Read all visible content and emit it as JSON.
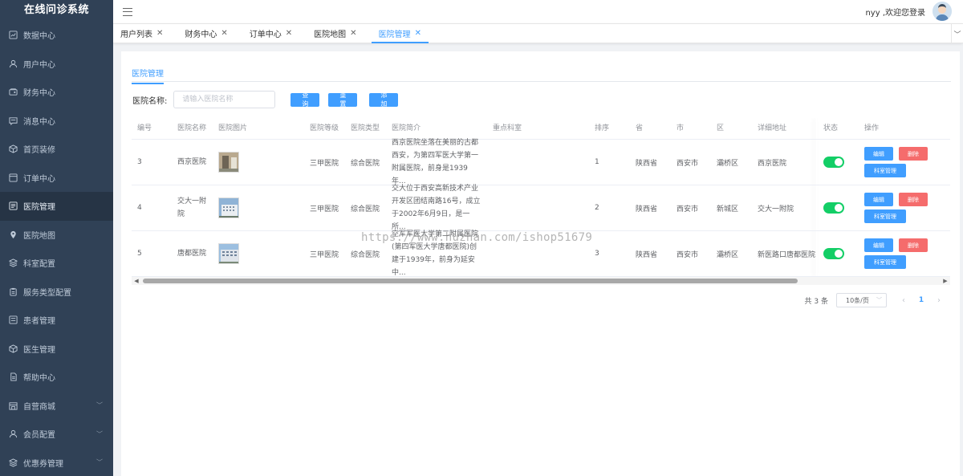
{
  "app": {
    "title": "在线问诊系统"
  },
  "sidebar": {
    "items": [
      {
        "label": "数据中心",
        "icon": "chart-icon"
      },
      {
        "label": "用户中心",
        "icon": "user-icon"
      },
      {
        "label": "财务中心",
        "icon": "wallet-icon"
      },
      {
        "label": "消息中心",
        "icon": "message-icon"
      },
      {
        "label": "首页装修",
        "icon": "box-icon"
      },
      {
        "label": "订单中心",
        "icon": "order-icon"
      },
      {
        "label": "医院管理",
        "icon": "list-icon"
      },
      {
        "label": "医院地图",
        "icon": "map-pin-icon"
      },
      {
        "label": "科室配置",
        "icon": "layers-icon"
      },
      {
        "label": "服务类型配置",
        "icon": "clipboard-icon"
      },
      {
        "label": "患者管理",
        "icon": "patient-icon"
      },
      {
        "label": "医生管理",
        "icon": "doctor-icon"
      },
      {
        "label": "帮助中心",
        "icon": "help-icon"
      },
      {
        "label": "自营商城",
        "icon": "shop-icon"
      },
      {
        "label": "会员配置",
        "icon": "member-icon"
      },
      {
        "label": "优惠券管理",
        "icon": "coupon-icon"
      }
    ]
  },
  "header": {
    "greeting": "nyy ,欢迎您登录"
  },
  "tabs": [
    {
      "label": "用户列表"
    },
    {
      "label": "财务中心"
    },
    {
      "label": "订单中心"
    },
    {
      "label": "医院地图"
    },
    {
      "label": "医院管理"
    }
  ],
  "page": {
    "tab_label": "医院管理"
  },
  "search": {
    "label": "医院名称:",
    "placeholder": "请输入医院名称",
    "query_label": "查询",
    "reset_label": "重置",
    "add_label": "添加"
  },
  "table": {
    "columns": [
      "编号",
      "医院名称",
      "医院图片",
      "医院等级",
      "医院类型",
      "医院简介",
      "重点科室",
      "排序",
      "省",
      "市",
      "区",
      "详细地址",
      "状态",
      "操作"
    ],
    "rows": [
      {
        "id": "3",
        "name": "西京医院",
        "level": "三甲医院",
        "type": "综合医院",
        "desc": "西京医院坐落在美丽的古都西安，为第四军医大学第一附属医院，前身是1939年...",
        "dept": "",
        "sort": "1",
        "province": "陕西省",
        "city": "西安市",
        "district": "灞桥区",
        "address": "西京医院",
        "status": true
      },
      {
        "id": "4",
        "name": "交大一附院",
        "level": "三甲医院",
        "type": "综合医院",
        "desc": "交大位于西安高新技术产业开发区团结南路16号，成立于2002年6月9日，是一所...",
        "dept": "",
        "sort": "2",
        "province": "陕西省",
        "city": "西安市",
        "district": "新城区",
        "address": "交大一附院",
        "status": true
      },
      {
        "id": "5",
        "name": "唐都医院",
        "level": "三甲医院",
        "type": "综合医院",
        "desc": "空军军医大学第二附属医院(第四军医大学唐都医院)创建于1939年，前身为延安中...",
        "dept": "",
        "sort": "3",
        "province": "陕西省",
        "city": "西安市",
        "district": "灞桥区",
        "address": "新医路口唐都医院",
        "status": true
      }
    ],
    "actions": {
      "edit": "编辑",
      "delete": "删除",
      "dept": "科室管理"
    }
  },
  "pagination": {
    "total": "共 3 条",
    "page_size": "10条/页",
    "current": "1"
  },
  "watermark": "https://www.huzhan.com/ishop51679",
  "colors": {
    "primary": "#409eff",
    "danger": "#f56c6c",
    "success": "#13ce66",
    "sidebar": "#304156"
  }
}
